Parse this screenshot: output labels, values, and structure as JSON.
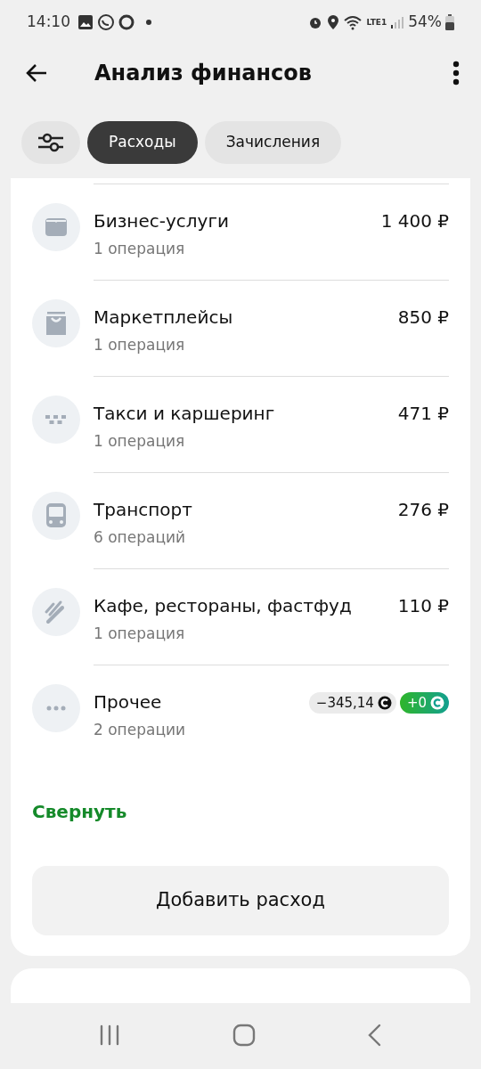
{
  "status_bar": {
    "time": "14:10",
    "battery": "54%",
    "network": "LTE1"
  },
  "header": {
    "title": "Анализ финансов"
  },
  "tabs": [
    {
      "label": "Расходы",
      "selected": true
    },
    {
      "label": "Зачисления",
      "selected": false
    }
  ],
  "categories": [
    {
      "kind": "card",
      "name": "Бизнес-услуги",
      "count": "1 операция",
      "amount": "1 400 ₽"
    },
    {
      "kind": "bag",
      "name": "Маркетплейсы",
      "count": "1 операция",
      "amount": "850 ₽"
    },
    {
      "kind": "taxi",
      "name": "Такси и каршеринг",
      "count": "1 операция",
      "amount": "471 ₽"
    },
    {
      "kind": "bus",
      "name": "Транспорт",
      "count": "6 операций",
      "amount": "276 ₽"
    },
    {
      "kind": "fork",
      "name": "Кафе, рестораны, фастфуд",
      "count": "1 операция",
      "amount": "110 ₽"
    },
    {
      "kind": "dots",
      "name": "Прочее",
      "count": "2 операции",
      "badges": [
        {
          "kind": "neutral",
          "text": "−345,14"
        },
        {
          "kind": "bonus",
          "text": "+0"
        }
      ]
    }
  ],
  "collapse_link": "Свернуть",
  "add_button": "Добавить расход"
}
